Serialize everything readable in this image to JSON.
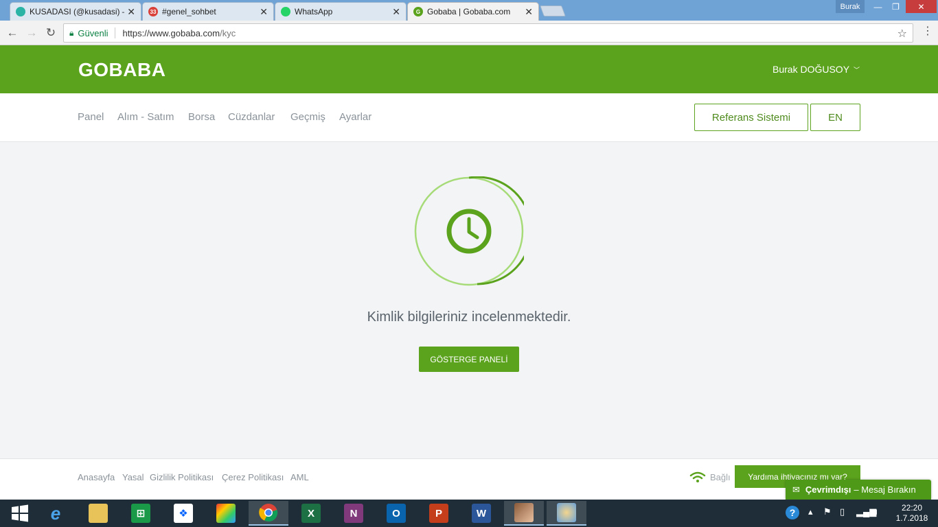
{
  "browser": {
    "tabs": [
      {
        "title": "KUSADASI (@kusadasi) –",
        "favicon_color": "#2bb3a6",
        "badge": ""
      },
      {
        "title": "#genel_sohbet",
        "favicon_color": "#d9423a",
        "badge": "33"
      },
      {
        "title": "WhatsApp",
        "favicon_color": "#25d366",
        "badge": ""
      },
      {
        "title": "Gobaba | Gobaba.com",
        "favicon_color": "#5ba21d",
        "badge": "G"
      }
    ],
    "window_user": "Burak",
    "security_label": "Güvenli",
    "url_host": "https://www.gobaba.com",
    "url_path": "/kyc"
  },
  "site": {
    "logo": "GOBABA",
    "user_name": "Burak DOĞUSOY",
    "nav": [
      "Panel",
      "Alım - Satım",
      "Borsa",
      "Cüzdanlar",
      "Geçmiş",
      "Ayarlar"
    ],
    "referral_button": "Referans Sistemi",
    "language_button": "EN",
    "accent_color": "#5ba21d"
  },
  "main": {
    "status_text": "Kimlik bilgileriniz incelenmektedir.",
    "dashboard_button": "GÖSTERGE PANELİ",
    "progress_icon": "clock-icon"
  },
  "footer": {
    "links": [
      "Anasayfa",
      "Yasal",
      "Gizlilik Politikası",
      "Çerez Politikası",
      "AML"
    ],
    "connection_status": "Bağlı",
    "help_button": "Yardıma ihtiyacınız mı var?",
    "chat_status": "Çevrimdışı",
    "chat_action": "– Mesaj Bırakın"
  },
  "taskbar": {
    "time": "22:20",
    "date": "1.7.2018",
    "apps": [
      "windows-start",
      "internet-explorer",
      "file-explorer",
      "store",
      "dropbox",
      "photo-app",
      "chrome",
      "excel",
      "onenote",
      "outlook",
      "powerpoint",
      "word",
      "game",
      "paint"
    ]
  }
}
